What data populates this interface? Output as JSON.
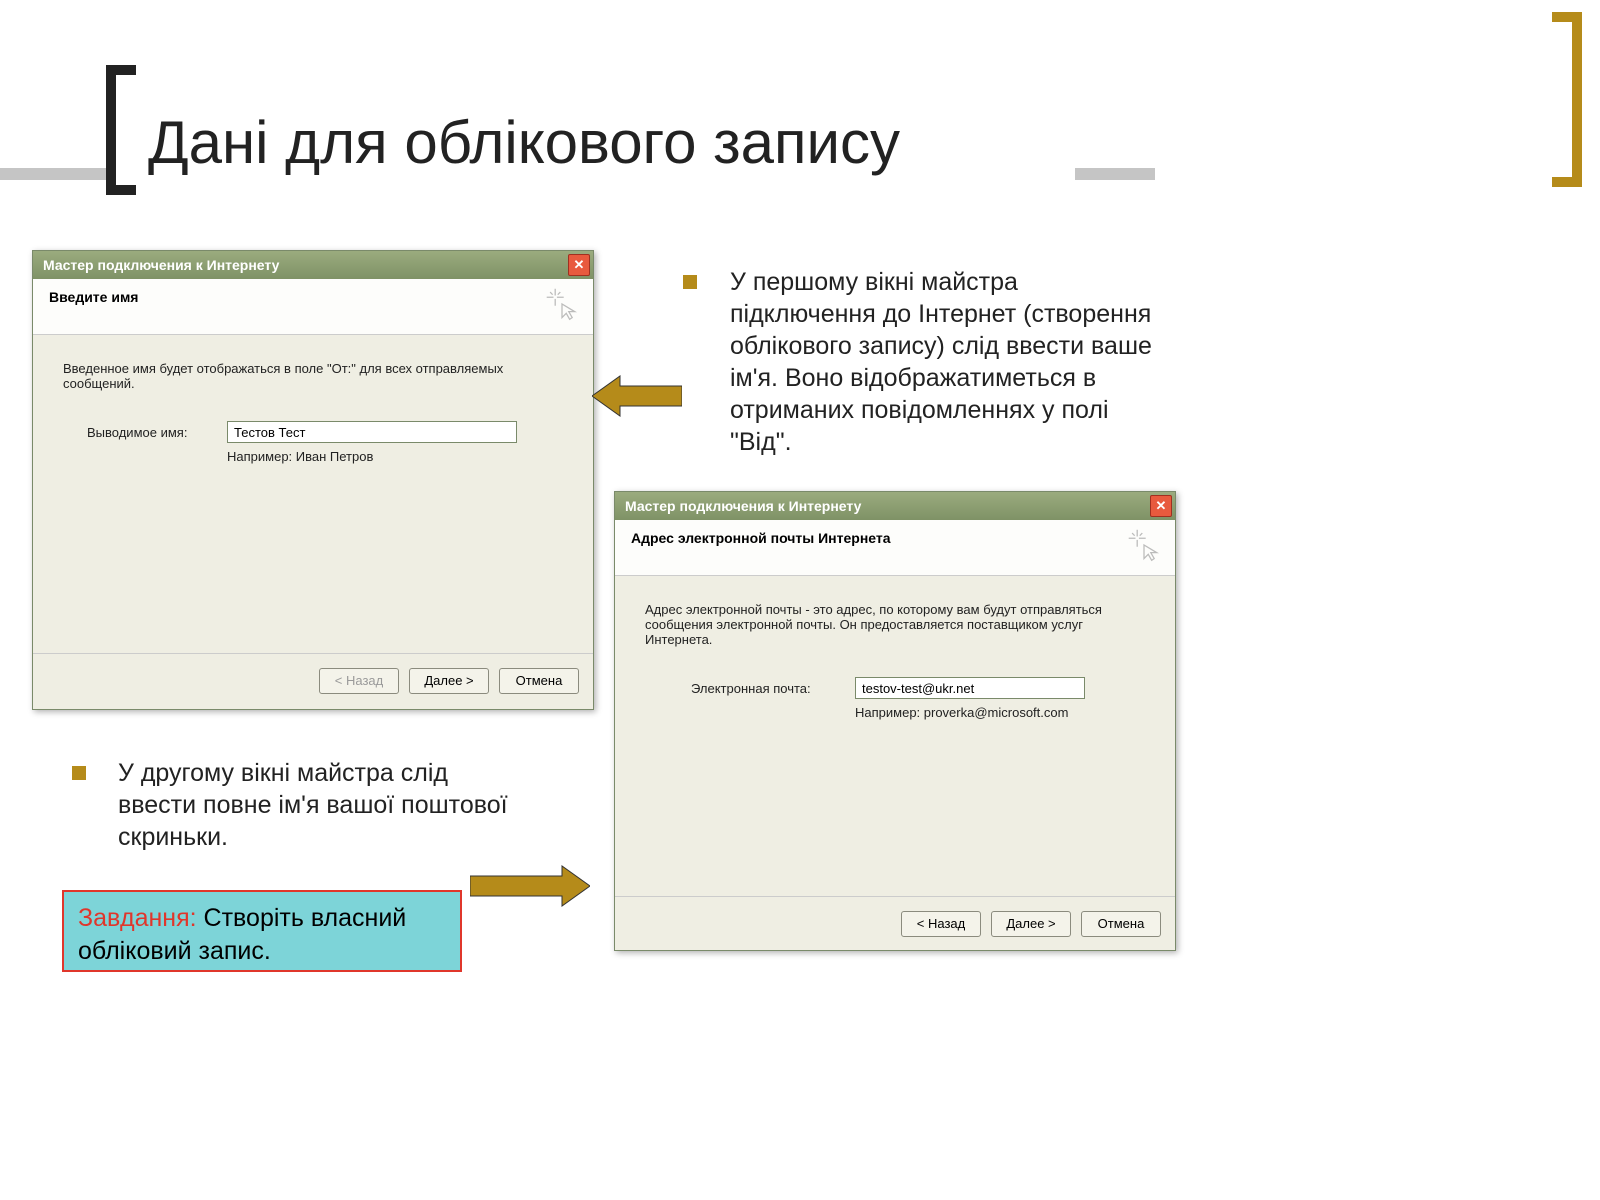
{
  "title": "Дані для облікового запису",
  "para1": "У першому вікні майстра підключення до Інтернет (створення облікового запису) слід ввести ваше ім'я. Воно відображатиметься в отриманих повідомленнях у полі \"Від\".",
  "para2": "У другому вікні майстра слід ввести повне ім'я вашої поштової скриньки.",
  "task": {
    "label": "Завдання:",
    "text": " Створіть власний обліковий запис."
  },
  "dialog1": {
    "title": "Мастер подключения к Интернету",
    "header": "Введите имя",
    "desc": "Введенное имя будет отображаться в поле \"От:\" для всех отправляемых сообщений.",
    "field_label": "Выводимое имя:",
    "field_value": "Тестов Тест",
    "example": "Например: Иван Петров",
    "back": "< Назад",
    "next": "Далее >",
    "cancel": "Отмена"
  },
  "dialog2": {
    "title": "Мастер подключения к Интернету",
    "header": "Адрес электронной почты Интернета",
    "desc": "Адрес электронной почты - это адрес, по которому вам будут отправляться сообщения электронной почты. Он предоставляется поставщиком услуг Интернета.",
    "field_label": "Электронная почта:",
    "field_value": "testov-test@ukr.net",
    "example": "Например: proverka@microsoft.com",
    "back": "< Назад",
    "next": "Далее >",
    "cancel": "Отмена"
  }
}
